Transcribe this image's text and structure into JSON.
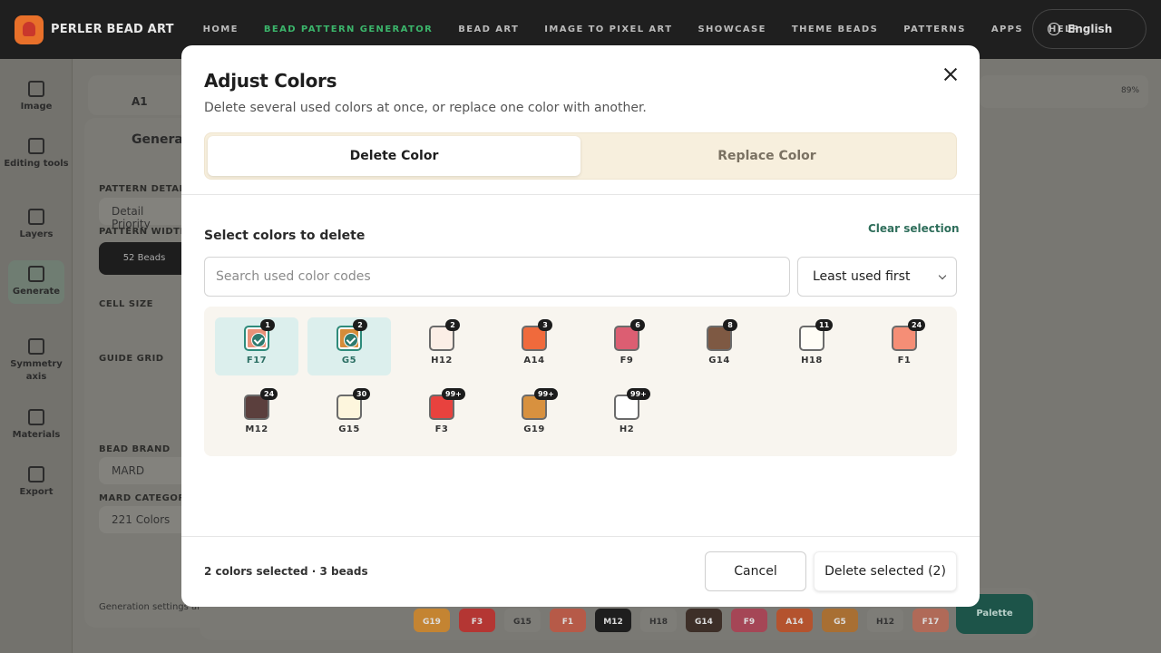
{
  "app": {
    "logo_text": "PERLER BEAD ART",
    "nav": [
      "HOME",
      "BEAD PATTERN GENERATOR",
      "BEAD ART",
      "IMAGE TO PIXEL ART",
      "SHOWCASE",
      "THEME BEADS",
      "PATTERNS",
      "APPS",
      "HELP"
    ],
    "active_nav": "BEAD PATTERN GENERATOR",
    "language": "English",
    "rail": [
      "Image",
      "Editing tools",
      "Layers",
      "Generate",
      "Symmetry axis",
      "Materials",
      "Export"
    ],
    "active_rail": "Generate",
    "selected_color": "A1",
    "panel": {
      "title": "Generate",
      "pattern_detail_label": "PATTERN DETAIL",
      "pattern_detail_value": "Detail Priority",
      "pattern_width_label": "PATTERN WIDTH",
      "pattern_width_value": "52 Beads",
      "cell_size_label": "CELL SIZE",
      "guide_grid_label": "GUIDE GRID",
      "bead_brand_label": "BEAD BRAND",
      "bead_brand_value": "MARD",
      "category_label": "MARD CATEGORY",
      "category_value": "221 Colors",
      "footer_note": "Generation settings are applied."
    },
    "zoom": "89%",
    "bottom_chips": [
      "G19",
      "F3",
      "G15",
      "F1",
      "M12",
      "H18",
      "G14",
      "F9",
      "A14",
      "G5",
      "H12",
      "F17"
    ],
    "palette_label": "Palette"
  },
  "modal": {
    "title": "Adjust Colors",
    "subtitle": "Delete several used colors at once, or replace one color with another.",
    "tabs": {
      "delete": "Delete Color",
      "replace": "Replace Color"
    },
    "active_tab": "delete",
    "section_title": "Select colors to delete",
    "clear_label": "Clear selection",
    "search_placeholder": "Search used color codes",
    "sort_value": "Least used first",
    "colors": [
      {
        "code": "F17",
        "count": "1",
        "hex": "#e89077",
        "selected": true
      },
      {
        "code": "G5",
        "count": "2",
        "hex": "#d58c3a",
        "selected": true
      },
      {
        "code": "H12",
        "count": "2",
        "hex": "#fbeee6",
        "selected": false
      },
      {
        "code": "A14",
        "count": "3",
        "hex": "#f06a3c",
        "selected": false
      },
      {
        "code": "F9",
        "count": "6",
        "hex": "#dc5e72",
        "selected": false
      },
      {
        "code": "G14",
        "count": "8",
        "hex": "#7e5943",
        "selected": false
      },
      {
        "code": "H18",
        "count": "11",
        "hex": "#fffdf6",
        "selected": false
      },
      {
        "code": "F1",
        "count": "24",
        "hex": "#f58e76",
        "selected": false
      },
      {
        "code": "M12",
        "count": "24",
        "hex": "#5b3f3d",
        "selected": false
      },
      {
        "code": "G15",
        "count": "30",
        "hex": "#fdf6dd",
        "selected": false
      },
      {
        "code": "F3",
        "count": "99+",
        "hex": "#e8423e",
        "selected": false
      },
      {
        "code": "G19",
        "count": "99+",
        "hex": "#d8913f",
        "selected": false
      },
      {
        "code": "H2",
        "count": "99+",
        "hex": "#ffffff",
        "selected": false
      }
    ],
    "summary": "2 colors selected · 3 beads",
    "cancel_label": "Cancel",
    "delete_label": "Delete selected (2)"
  }
}
